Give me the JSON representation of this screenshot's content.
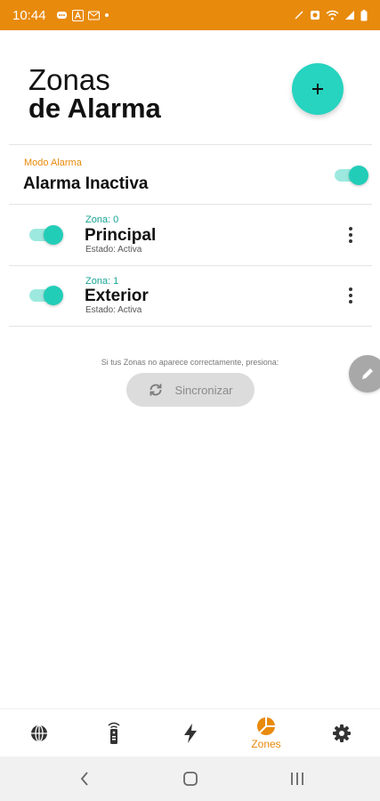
{
  "status_bar": {
    "time": "10:44",
    "bg_color": "#e88a0c",
    "left_icons": [
      "chat-bubble-icon",
      "a-square-icon",
      "mail-icon",
      "dot-icon"
    ],
    "right_icons": [
      "mute-icon",
      "alarm-icon",
      "wifi-icon",
      "signal-icon",
      "battery-icon"
    ]
  },
  "header": {
    "title_line1": "Zonas",
    "title_line2": "de Alarma",
    "add_button_icon": "plus-icon"
  },
  "mode": {
    "label": "Modo Alarma",
    "value": "Alarma Inactiva",
    "toggle_on": true
  },
  "zones": [
    {
      "code": "Zona: 0",
      "name": "Principal",
      "state": "Estado: Activa",
      "toggle_on": true
    },
    {
      "code": "Zona: 1",
      "name": "Exterior",
      "state": "Estado: Activa",
      "toggle_on": true
    }
  ],
  "sync": {
    "hint": "Si tus Zonas no aparece correctamente, presiona:",
    "button_label": "Sincronizar"
  },
  "bottom_nav": {
    "items": [
      {
        "icon": "globe-icon",
        "label": ""
      },
      {
        "icon": "remote-control-icon",
        "label": ""
      },
      {
        "icon": "lightning-icon",
        "label": ""
      },
      {
        "icon": "zones-pie-icon",
        "label": "Zones",
        "active": true
      },
      {
        "icon": "gear-icon",
        "label": ""
      }
    ]
  },
  "colors": {
    "accent_orange": "#e88a0c",
    "teal": "#26d4c0",
    "zone_code": "#16a394"
  }
}
